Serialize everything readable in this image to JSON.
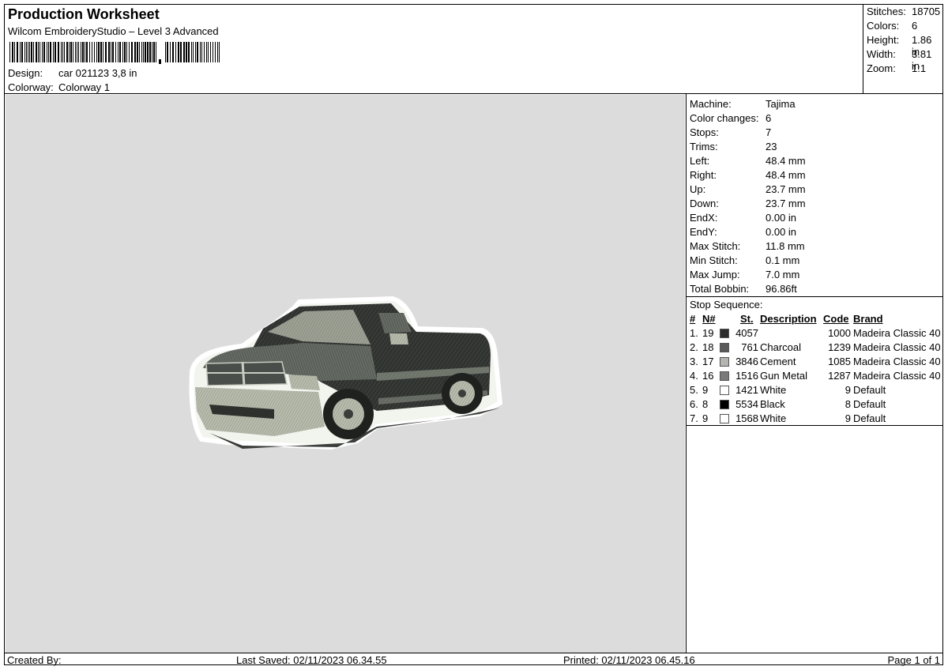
{
  "header": {
    "title": "Production Worksheet",
    "subtitle": "Wilcom EmbroideryStudio – Level 3 Advanced",
    "design_label": "Design:",
    "design_value": "car 021123 3,8 in",
    "colorway_label": "Colorway:",
    "colorway_value": "Colorway 1"
  },
  "summary": {
    "stitches_label": "Stitches:",
    "stitches": "18705",
    "colors_label": "Colors:",
    "colors": "6",
    "height_label": "Height:",
    "height": "1.86 in",
    "width_label": "Width:",
    "width": "3.81 in",
    "zoom_label": "Zoom:",
    "zoom": "1:1"
  },
  "details": {
    "machine_label": "Machine:",
    "machine": "Tajima",
    "color_changes_label": "Color changes:",
    "color_changes": "6",
    "stops_label": "Stops:",
    "stops": "7",
    "trims_label": "Trims:",
    "trims": "23",
    "left_label": "Left:",
    "left": "48.4 mm",
    "right_label": "Right:",
    "right": "48.4 mm",
    "up_label": "Up:",
    "up": "23.7 mm",
    "down_label": "Down:",
    "down": "23.7 mm",
    "endx_label": "EndX:",
    "endx": "0.00 in",
    "endy_label": "EndY:",
    "endy": "0.00 in",
    "max_stitch_label": "Max Stitch:",
    "max_stitch": "11.8 mm",
    "min_stitch_label": "Min Stitch:",
    "min_stitch": "0.1 mm",
    "max_jump_label": "Max Jump:",
    "max_jump": "7.0 mm",
    "total_bobbin_label": "Total Bobbin:",
    "total_bobbin": "96.86ft"
  },
  "stop_sequence": {
    "title": "Stop Sequence:",
    "headers": {
      "num": "#",
      "n": "N#",
      "st": "St.",
      "description": "Description",
      "code": "Code",
      "brand": "Brand"
    },
    "rows": [
      {
        "num": "1.",
        "n": "19",
        "color": "#2b2b2b",
        "st": "4057",
        "description": "",
        "code": "1000",
        "brand": "Madeira Classic 40"
      },
      {
        "num": "2.",
        "n": "18",
        "color": "#5a5a5a",
        "st": "761",
        "description": "Charcoal",
        "code": "1239",
        "brand": "Madeira Classic 40"
      },
      {
        "num": "3.",
        "n": "17",
        "color": "#b4b4b0",
        "st": "3846",
        "description": "Cement",
        "code": "1085",
        "brand": "Madeira Classic 40"
      },
      {
        "num": "4.",
        "n": "16",
        "color": "#7a7a7a",
        "st": "1516",
        "description": "Gun Metal",
        "code": "1287",
        "brand": "Madeira Classic 40"
      },
      {
        "num": "5.",
        "n": "9",
        "color": "#ffffff",
        "st": "1421",
        "description": "White",
        "code": "9",
        "brand": "Default"
      },
      {
        "num": "6.",
        "n": "8",
        "color": "#000000",
        "st": "5534",
        "description": "Black",
        "code": "8",
        "brand": "Default"
      },
      {
        "num": "7.",
        "n": "9",
        "color": "#ffffff",
        "st": "1568",
        "description": "White",
        "code": "9",
        "brand": "Default"
      }
    ]
  },
  "footer": {
    "created_by": "Created By:",
    "last_saved": "Last Saved: 02/11/2023 06.34.55",
    "printed": "Printed: 02/11/2023 06.45.16",
    "page": "Page 1 of 1"
  }
}
